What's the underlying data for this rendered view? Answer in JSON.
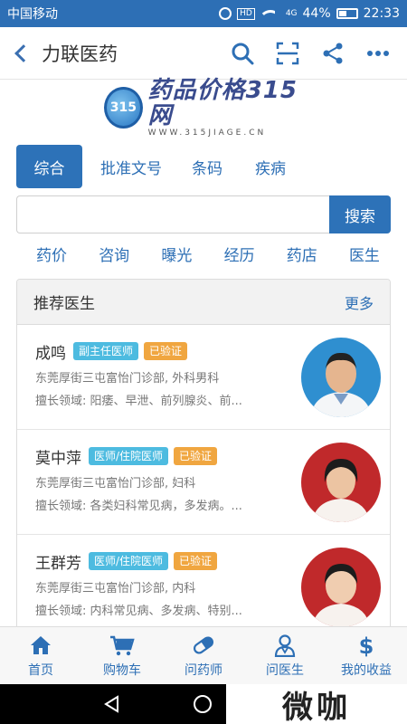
{
  "status_bar": {
    "carrier": "中国移动",
    "network": "4G",
    "battery": "44%",
    "time": "22:33"
  },
  "header": {
    "title": "力联医药"
  },
  "logo": {
    "main": "药品价格315网",
    "sub": "WWW.315JIAGE.CN",
    "badge": "315"
  },
  "tabs": [
    {
      "label": "综合",
      "active": true
    },
    {
      "label": "批准文号",
      "active": false
    },
    {
      "label": "条码",
      "active": false
    },
    {
      "label": "疾病",
      "active": false
    }
  ],
  "search": {
    "placeholder": "",
    "value": "",
    "button_label": "搜索"
  },
  "categories": [
    "药价",
    "咨询",
    "曝光",
    "经历",
    "药店",
    "医生"
  ],
  "recommended": {
    "title": "推荐医生",
    "more_label": "更多",
    "doctors": [
      {
        "name": "成鸣",
        "title_badge": "副主任医师",
        "verified_badge": "已验证",
        "address": "东莞厚街三屯富怡门诊部, 外科男科",
        "specialty": "擅长领域: 阳痿、早泄、前列腺炎、前..."
      },
      {
        "name": "莫中萍",
        "title_badge": "医师/住院医师",
        "verified_badge": "已验证",
        "address": "东莞厚街三屯富怡门诊部, 妇科",
        "specialty": "擅长领域: 各类妇科常见病，多发病。..."
      },
      {
        "name": "王群芳",
        "title_badge": "医师/住院医师",
        "verified_badge": "已验证",
        "address": "东莞厚街三屯富怡门诊部, 内科",
        "specialty": "擅长领域: 内科常见病、多发病、特别..."
      }
    ]
  },
  "bottom_nav": [
    {
      "label": "首页",
      "icon": "home-icon"
    },
    {
      "label": "购物车",
      "icon": "cart-icon"
    },
    {
      "label": "问药师",
      "icon": "pill-icon"
    },
    {
      "label": "问医生",
      "icon": "doctor-icon"
    },
    {
      "label": "我的收益",
      "icon": "dollar-icon"
    }
  ],
  "watermark": "微咖",
  "colors": {
    "primary": "#2d72b8",
    "badge_blue": "#4dbbe0",
    "badge_orange": "#f0a640",
    "status_bar": "#2d6fb5"
  }
}
